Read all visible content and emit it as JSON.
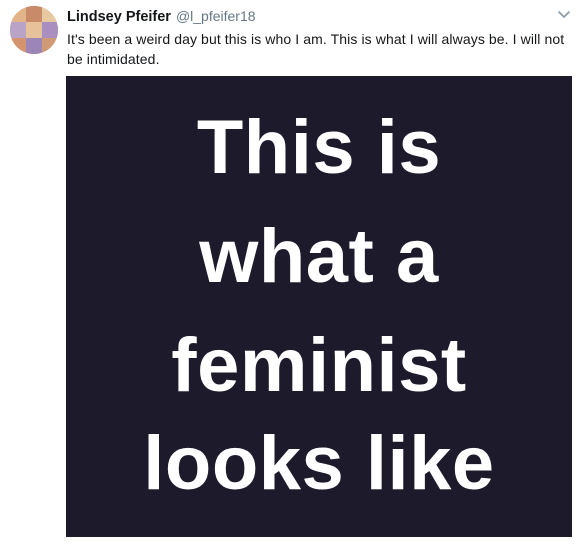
{
  "tweet": {
    "display_name": "Lindsey Pfeifer",
    "handle": "@l_pfeifer18",
    "text": "It's been a weird day but this is who I am. This is what I will always be. I will not be intimidated.",
    "media": {
      "lines": [
        "This is",
        "what a",
        "feminist",
        "looks like"
      ],
      "background_color": "#1c1a2b",
      "text_color": "#ffffff"
    },
    "icons": {
      "avatar": "profile-photo",
      "menu": "chevron-down-icon"
    }
  }
}
